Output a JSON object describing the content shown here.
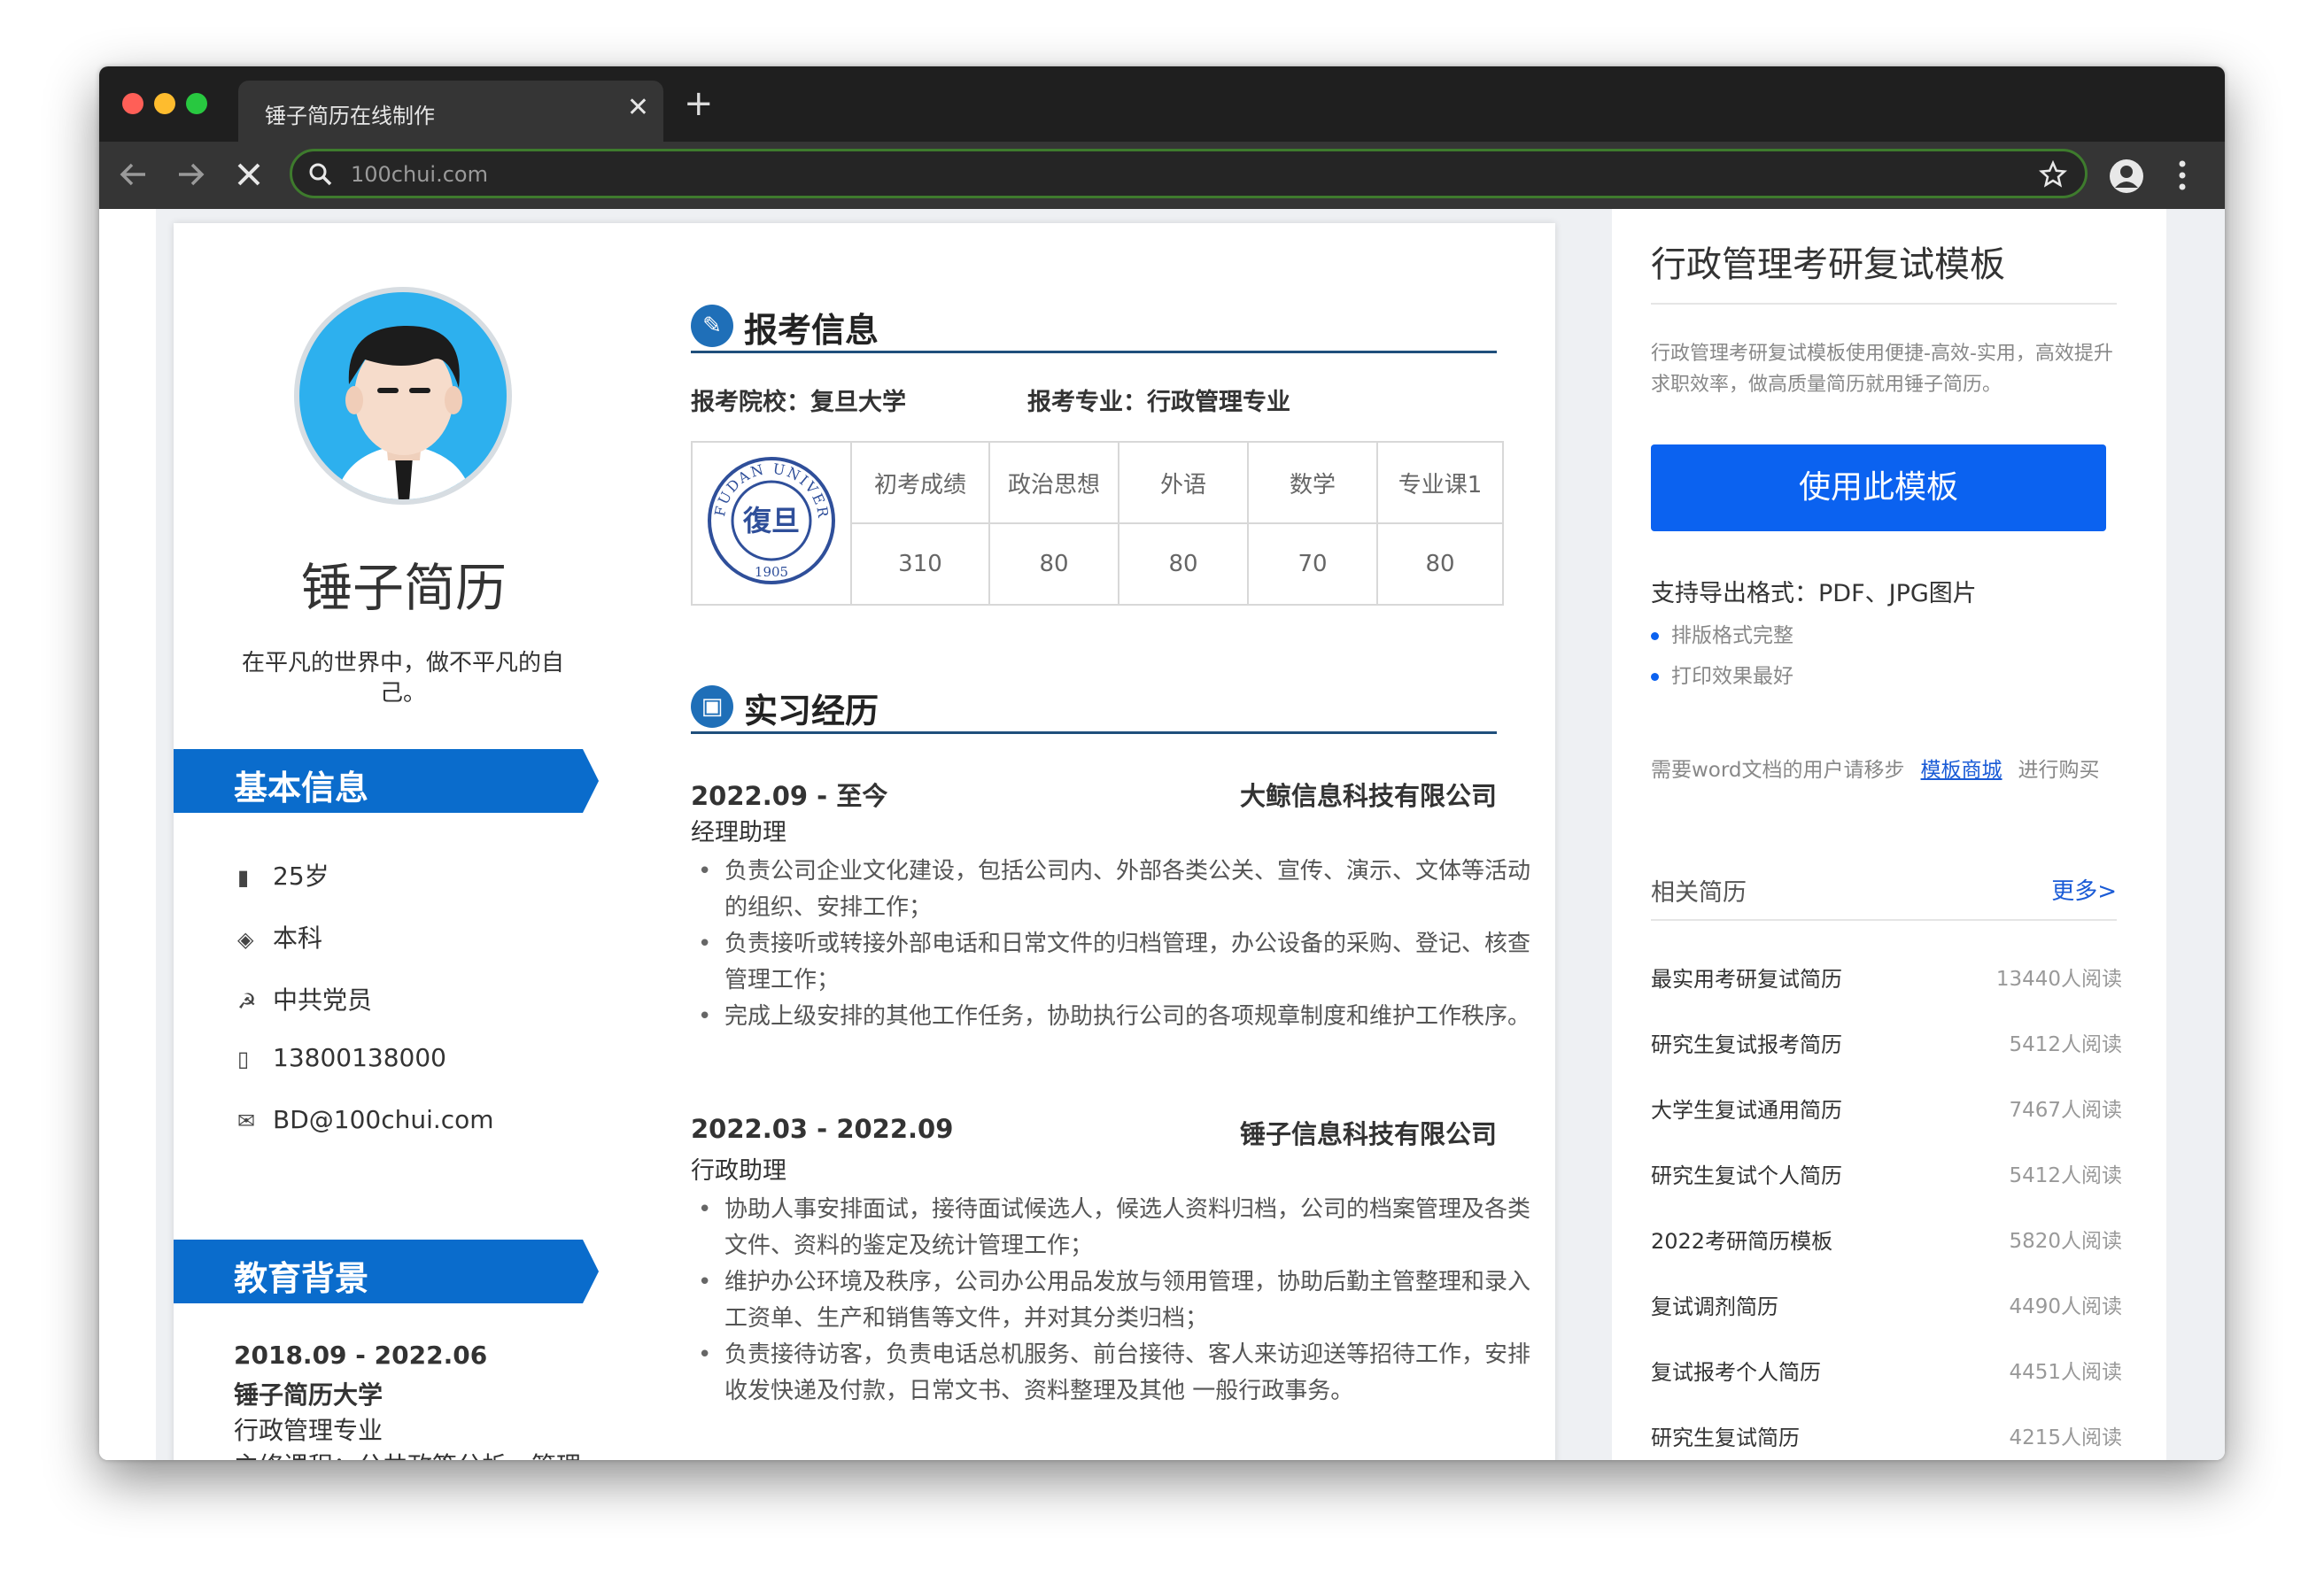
{
  "browser": {
    "tab_title": "锤子简历在线制作",
    "close_glyph": "✕",
    "new_tab_glyph": "+",
    "url": "100chui.com",
    "traffic_lights": [
      "#ff5f57",
      "#febc2e",
      "#28c840"
    ]
  },
  "resume": {
    "name": "锤子简历",
    "motto": "在平凡的世界中，做不平凡的自己。",
    "basic_title": "基本信息",
    "basic_info": [
      {
        "icon": "bar-chart-icon",
        "glyph": "▮",
        "text": "25岁"
      },
      {
        "icon": "graduation-cap-icon",
        "glyph": "◈",
        "text": "本科"
      },
      {
        "icon": "party-emblem-icon",
        "glyph": "☭",
        "text": "中共党员"
      },
      {
        "icon": "phone-icon",
        "glyph": "▯",
        "text": "13800138000"
      },
      {
        "icon": "mail-icon",
        "glyph": "✉",
        "text": "BD@100chui.com"
      }
    ],
    "edu_title": "教育背景",
    "edu": {
      "period": "2018.09 - 2022.06",
      "school": "锤子简历大学",
      "major": "行政管理专业",
      "courses": "主修课程：公共政策分析、管理"
    },
    "apply": {
      "title": "报考信息",
      "school": "报考院校：复旦大学",
      "major": "报考专业：行政管理专业",
      "score_headers": [
        "初考成绩",
        "政治思想",
        "外语",
        "数学",
        "专业课1"
      ],
      "score_values": [
        "310",
        "80",
        "80",
        "70",
        "80"
      ],
      "seal_text_top": "FUDAN UNIVERSITY",
      "seal_year": "1905",
      "seal_char": "復旦"
    },
    "intern": {
      "title": "实习经历",
      "jobs": [
        {
          "period": "2022.09 - 至今",
          "company": "大鲸信息科技有限公司",
          "role": "经理助理",
          "bullets": [
            "负责公司企业文化建设，包括公司内、外部各类公关、宣传、演示、文体等活动的组织、安排工作；",
            "负责接听或转接外部电话和日常文件的归档管理，办公设备的采购、登记、核查管理工作；",
            "完成上级安排的其他工作任务，协助执行公司的各项规章制度和维护工作秩序。"
          ]
        },
        {
          "period": "2022.03 - 2022.09",
          "company": "锤子信息科技有限公司",
          "role": "行政助理",
          "bullets": [
            "协助人事安排面试，接待面试候选人，候选人资料归档，公司的档案管理及各类文件、资料的鉴定及统计管理工作；",
            "维护办公环境及秩序，公司办公用品发放与领用管理，协助后勤主管整理和录入工资单、生产和销售等文件，并对其分类归档；",
            "负责接待访客，负责电话总机服务、前台接待、客人来访迎送等招待工作，安排收发快递及付款，日常文书、资料整理及其他 一般行政事务。"
          ]
        }
      ]
    }
  },
  "panel": {
    "title": "行政管理考研复试模板",
    "desc": "行政管理考研复试模板使用便捷-高效-实用，高效提升求职效率，做高质量简历就用锤子简历。",
    "use_button": "使用此模板",
    "formats": "支持导出格式：PDF、JPG图片",
    "points": [
      "排版格式完整",
      "打印效果最好"
    ],
    "note_prefix": "需要word文档的用户请移步",
    "note_link": "模板商城",
    "note_suffix": "进行购买",
    "related_title": "相关简历",
    "more": "更多>",
    "related": [
      {
        "name": "最实用考研复试简历",
        "count": "13440人阅读"
      },
      {
        "name": "研究生复试报考简历",
        "count": "5412人阅读"
      },
      {
        "name": "大学生复试通用简历",
        "count": "7467人阅读"
      },
      {
        "name": "研究生复试个人简历",
        "count": "5412人阅读"
      },
      {
        "name": "2022考研简历模板",
        "count": "5820人阅读"
      },
      {
        "name": "复试调剂简历",
        "count": "4490人阅读"
      },
      {
        "name": "复试报考个人简历",
        "count": "4451人阅读"
      },
      {
        "name": "研究生复试简历",
        "count": "4215人阅读"
      }
    ],
    "accent": "#0b62f0"
  }
}
